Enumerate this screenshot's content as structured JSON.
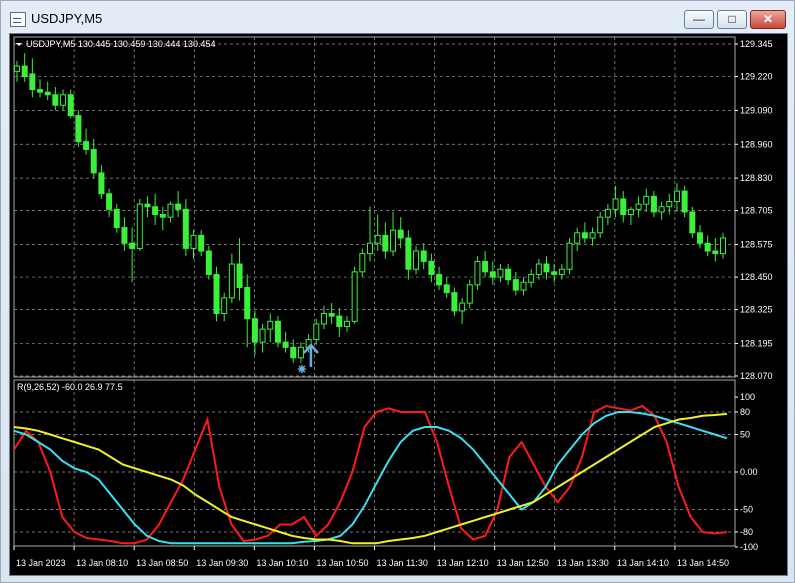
{
  "window": {
    "title": "USDJPY,M5",
    "minimize_glyph": "—",
    "maximize_glyph": "□",
    "close_glyph": "✕"
  },
  "chart": {
    "info": "USDJPY,M5  130.445 130.459 130.444 130.454",
    "price_ticks": [
      "129.345",
      "129.220",
      "129.090",
      "128.960",
      "128.830",
      "128.705",
      "128.575",
      "128.450",
      "128.325",
      "128.195",
      "128.070"
    ],
    "indicator_label": "R(9,26,52) -60.0 26.9 77.5",
    "indicator_ticks": [
      "100",
      "80",
      "50",
      "0.00",
      "-50",
      "-80",
      "-100"
    ],
    "time_ticks": [
      "13 Jan 2023",
      "13 Jan 08:10",
      "13 Jan 08:50",
      "13 Jan 09:30",
      "13 Jan 10:10",
      "13 Jan 10:50",
      "13 Jan 11:30",
      "13 Jan 12:10",
      "13 Jan 12:50",
      "13 Jan 13:30",
      "13 Jan 14:10",
      "13 Jan 14:50"
    ],
    "colors": {
      "background": "#000000",
      "grid": "#9a9a9a",
      "candle": "#3bf03b",
      "fast": "#ff1a1a",
      "medium": "#38e0f0",
      "slow": "#f0f02a",
      "arrow": "#6aaee6"
    }
  },
  "chart_data": {
    "type": "candlestick",
    "symbol": "USDJPY",
    "timeframe": "M5",
    "price_range": [
      128.07,
      129.345
    ],
    "candles": [
      {
        "o": 129.24,
        "h": 129.28,
        "l": 129.2,
        "c": 129.26
      },
      {
        "o": 129.26,
        "h": 129.31,
        "l": 129.2,
        "c": 129.22
      },
      {
        "o": 129.23,
        "h": 129.29,
        "l": 129.14,
        "c": 129.17
      },
      {
        "o": 129.17,
        "h": 129.21,
        "l": 129.14,
        "c": 129.16
      },
      {
        "o": 129.16,
        "h": 129.2,
        "l": 129.13,
        "c": 129.15
      },
      {
        "o": 129.15,
        "h": 129.18,
        "l": 129.09,
        "c": 129.11
      },
      {
        "o": 129.11,
        "h": 129.17,
        "l": 129.09,
        "c": 129.15
      },
      {
        "o": 129.15,
        "h": 129.17,
        "l": 129.06,
        "c": 129.07
      },
      {
        "o": 129.07,
        "h": 129.09,
        "l": 128.95,
        "c": 128.97
      },
      {
        "o": 128.97,
        "h": 129.02,
        "l": 128.92,
        "c": 128.94
      },
      {
        "o": 128.94,
        "h": 128.98,
        "l": 128.83,
        "c": 128.85
      },
      {
        "o": 128.85,
        "h": 128.88,
        "l": 128.75,
        "c": 128.77
      },
      {
        "o": 128.77,
        "h": 128.79,
        "l": 128.68,
        "c": 128.71
      },
      {
        "o": 128.71,
        "h": 128.73,
        "l": 128.62,
        "c": 128.64
      },
      {
        "o": 128.64,
        "h": 128.68,
        "l": 128.55,
        "c": 128.58
      },
      {
        "o": 128.58,
        "h": 128.64,
        "l": 128.43,
        "c": 128.56
      },
      {
        "o": 128.56,
        "h": 128.75,
        "l": 128.55,
        "c": 128.73
      },
      {
        "o": 128.73,
        "h": 128.76,
        "l": 128.68,
        "c": 128.72
      },
      {
        "o": 128.72,
        "h": 128.77,
        "l": 128.65,
        "c": 128.69
      },
      {
        "o": 128.69,
        "h": 128.72,
        "l": 128.63,
        "c": 128.68
      },
      {
        "o": 128.68,
        "h": 128.74,
        "l": 128.66,
        "c": 128.73
      },
      {
        "o": 128.73,
        "h": 128.78,
        "l": 128.68,
        "c": 128.71
      },
      {
        "o": 128.71,
        "h": 128.75,
        "l": 128.53,
        "c": 128.56
      },
      {
        "o": 128.56,
        "h": 128.63,
        "l": 128.52,
        "c": 128.61
      },
      {
        "o": 128.61,
        "h": 128.63,
        "l": 128.53,
        "c": 128.55
      },
      {
        "o": 128.55,
        "h": 128.57,
        "l": 128.44,
        "c": 128.46
      },
      {
        "o": 128.46,
        "h": 128.49,
        "l": 128.28,
        "c": 128.31
      },
      {
        "o": 128.31,
        "h": 128.39,
        "l": 128.28,
        "c": 128.37
      },
      {
        "o": 128.37,
        "h": 128.54,
        "l": 128.35,
        "c": 128.5
      },
      {
        "o": 128.5,
        "h": 128.6,
        "l": 128.36,
        "c": 128.41
      },
      {
        "o": 128.41,
        "h": 128.46,
        "l": 128.18,
        "c": 128.29
      },
      {
        "o": 128.29,
        "h": 128.32,
        "l": 128.15,
        "c": 128.2
      },
      {
        "o": 128.2,
        "h": 128.27,
        "l": 128.16,
        "c": 128.25
      },
      {
        "o": 128.25,
        "h": 128.31,
        "l": 128.2,
        "c": 128.28
      },
      {
        "o": 128.28,
        "h": 128.3,
        "l": 128.18,
        "c": 128.2
      },
      {
        "o": 128.2,
        "h": 128.24,
        "l": 128.16,
        "c": 128.18
      },
      {
        "o": 128.18,
        "h": 128.21,
        "l": 128.12,
        "c": 128.14
      },
      {
        "o": 128.14,
        "h": 128.2,
        "l": 128.12,
        "c": 128.18
      },
      {
        "o": 128.18,
        "h": 128.23,
        "l": 128.16,
        "c": 128.21
      },
      {
        "o": 128.21,
        "h": 128.29,
        "l": 128.19,
        "c": 128.27
      },
      {
        "o": 128.27,
        "h": 128.34,
        "l": 128.25,
        "c": 128.31
      },
      {
        "o": 128.31,
        "h": 128.35,
        "l": 128.27,
        "c": 128.3
      },
      {
        "o": 128.3,
        "h": 128.33,
        "l": 128.22,
        "c": 128.26
      },
      {
        "o": 128.26,
        "h": 128.3,
        "l": 128.24,
        "c": 128.28
      },
      {
        "o": 128.28,
        "h": 128.49,
        "l": 128.27,
        "c": 128.47
      },
      {
        "o": 128.47,
        "h": 128.56,
        "l": 128.45,
        "c": 128.54
      },
      {
        "o": 128.54,
        "h": 128.72,
        "l": 128.51,
        "c": 128.58
      },
      {
        "o": 128.58,
        "h": 128.69,
        "l": 128.55,
        "c": 128.61
      },
      {
        "o": 128.61,
        "h": 128.66,
        "l": 128.52,
        "c": 128.55
      },
      {
        "o": 128.55,
        "h": 128.7,
        "l": 128.53,
        "c": 128.63
      },
      {
        "o": 128.63,
        "h": 128.68,
        "l": 128.56,
        "c": 128.6
      },
      {
        "o": 128.6,
        "h": 128.63,
        "l": 128.44,
        "c": 128.48
      },
      {
        "o": 128.48,
        "h": 128.57,
        "l": 128.46,
        "c": 128.55
      },
      {
        "o": 128.55,
        "h": 128.58,
        "l": 128.48,
        "c": 128.51
      },
      {
        "o": 128.51,
        "h": 128.54,
        "l": 128.43,
        "c": 128.46
      },
      {
        "o": 128.46,
        "h": 128.49,
        "l": 128.4,
        "c": 128.42
      },
      {
        "o": 128.42,
        "h": 128.45,
        "l": 128.37,
        "c": 128.39
      },
      {
        "o": 128.39,
        "h": 128.41,
        "l": 128.3,
        "c": 128.32
      },
      {
        "o": 128.32,
        "h": 128.37,
        "l": 128.27,
        "c": 128.35
      },
      {
        "o": 128.35,
        "h": 128.44,
        "l": 128.33,
        "c": 128.42
      },
      {
        "o": 128.42,
        "h": 128.53,
        "l": 128.4,
        "c": 128.51
      },
      {
        "o": 128.51,
        "h": 128.55,
        "l": 128.45,
        "c": 128.47
      },
      {
        "o": 128.47,
        "h": 128.51,
        "l": 128.42,
        "c": 128.45
      },
      {
        "o": 128.45,
        "h": 128.5,
        "l": 128.43,
        "c": 128.48
      },
      {
        "o": 128.48,
        "h": 128.5,
        "l": 128.42,
        "c": 128.44
      },
      {
        "o": 128.44,
        "h": 128.47,
        "l": 128.38,
        "c": 128.4
      },
      {
        "o": 128.4,
        "h": 128.45,
        "l": 128.38,
        "c": 128.43
      },
      {
        "o": 128.43,
        "h": 128.48,
        "l": 128.41,
        "c": 128.46
      },
      {
        "o": 128.46,
        "h": 128.52,
        "l": 128.44,
        "c": 128.5
      },
      {
        "o": 128.5,
        "h": 128.53,
        "l": 128.44,
        "c": 128.47
      },
      {
        "o": 128.47,
        "h": 128.5,
        "l": 128.43,
        "c": 128.46
      },
      {
        "o": 128.46,
        "h": 128.5,
        "l": 128.44,
        "c": 128.48
      },
      {
        "o": 128.48,
        "h": 128.6,
        "l": 128.46,
        "c": 128.58
      },
      {
        "o": 128.58,
        "h": 128.64,
        "l": 128.55,
        "c": 128.62
      },
      {
        "o": 128.62,
        "h": 128.66,
        "l": 128.58,
        "c": 128.6
      },
      {
        "o": 128.6,
        "h": 128.64,
        "l": 128.57,
        "c": 128.62
      },
      {
        "o": 128.62,
        "h": 128.7,
        "l": 128.6,
        "c": 128.68
      },
      {
        "o": 128.68,
        "h": 128.73,
        "l": 128.65,
        "c": 128.71
      },
      {
        "o": 128.71,
        "h": 128.8,
        "l": 128.68,
        "c": 128.75
      },
      {
        "o": 128.75,
        "h": 128.78,
        "l": 128.66,
        "c": 128.69
      },
      {
        "o": 128.69,
        "h": 128.72,
        "l": 128.65,
        "c": 128.71
      },
      {
        "o": 128.71,
        "h": 128.76,
        "l": 128.68,
        "c": 128.73
      },
      {
        "o": 128.73,
        "h": 128.79,
        "l": 128.7,
        "c": 128.76
      },
      {
        "o": 128.76,
        "h": 128.78,
        "l": 128.68,
        "c": 128.7
      },
      {
        "o": 128.7,
        "h": 128.74,
        "l": 128.67,
        "c": 128.72
      },
      {
        "o": 128.72,
        "h": 128.77,
        "l": 128.69,
        "c": 128.74
      },
      {
        "o": 128.74,
        "h": 128.81,
        "l": 128.7,
        "c": 128.78
      },
      {
        "o": 128.78,
        "h": 128.8,
        "l": 128.68,
        "c": 128.7
      },
      {
        "o": 128.7,
        "h": 128.72,
        "l": 128.6,
        "c": 128.62
      },
      {
        "o": 128.62,
        "h": 128.65,
        "l": 128.56,
        "c": 128.58
      },
      {
        "o": 128.58,
        "h": 128.61,
        "l": 128.53,
        "c": 128.55
      },
      {
        "o": 128.55,
        "h": 128.6,
        "l": 128.51,
        "c": 128.54
      },
      {
        "o": 128.54,
        "h": 128.62,
        "l": 128.52,
        "c": 128.6
      }
    ],
    "buy_signal": {
      "candle_index": 37,
      "price": 128.12
    },
    "indicator": {
      "name": "R(9,26,52)",
      "range": [
        -100,
        100
      ],
      "levels": [
        80,
        50,
        0,
        -50,
        -80
      ],
      "last_values": [
        -60.0,
        26.9,
        77.5
      ],
      "series": [
        {
          "values": [
            30,
            55,
            40,
            0,
            -60,
            -80,
            -88,
            -90,
            -92,
            -95,
            -95,
            -90,
            -70,
            -40,
            -10,
            30,
            70,
            -20,
            -70,
            -92,
            -90,
            -85,
            -70,
            -70,
            -60,
            -85,
            -70,
            -40,
            0,
            60,
            80,
            85,
            80,
            80,
            80,
            40,
            -20,
            -75,
            -90,
            -85,
            -50,
            20,
            40,
            10,
            -20,
            -40,
            -20,
            20,
            80,
            88,
            85,
            82,
            88,
            75,
            40,
            -20,
            -60,
            -80,
            -82,
            -80
          ]
        },
        {
          "values": [
            55,
            50,
            40,
            30,
            15,
            5,
            0,
            -10,
            -30,
            -50,
            -70,
            -85,
            -92,
            -95,
            -95,
            -95,
            -95,
            -95,
            -95,
            -95,
            -95,
            -95,
            -95,
            -95,
            -93,
            -92,
            -90,
            -85,
            -70,
            -45,
            -15,
            15,
            40,
            55,
            60,
            60,
            55,
            45,
            30,
            10,
            -10,
            -30,
            -50,
            -40,
            -20,
            10,
            30,
            50,
            65,
            75,
            80,
            80,
            78,
            75,
            70,
            65,
            60,
            55,
            50,
            45
          ]
        },
        {
          "values": [
            60,
            58,
            55,
            50,
            45,
            40,
            35,
            30,
            20,
            10,
            5,
            0,
            -5,
            -10,
            -18,
            -30,
            -40,
            -50,
            -60,
            -65,
            -70,
            -75,
            -80,
            -85,
            -88,
            -90,
            -90,
            -92,
            -95,
            -95,
            -95,
            -92,
            -90,
            -88,
            -85,
            -80,
            -75,
            -70,
            -65,
            -60,
            -55,
            -50,
            -45,
            -40,
            -30,
            -20,
            -10,
            0,
            10,
            20,
            30,
            40,
            50,
            60,
            65,
            70,
            72,
            75,
            76,
            77.5
          ]
        }
      ]
    }
  }
}
